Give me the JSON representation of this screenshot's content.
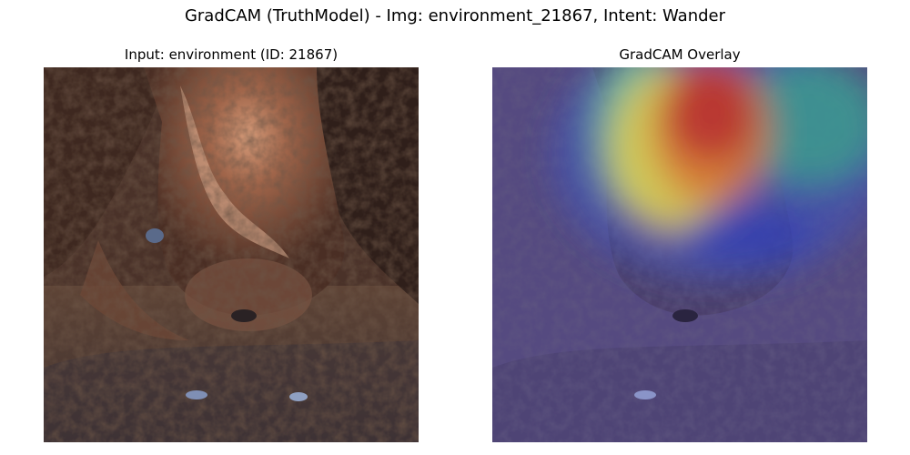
{
  "figure": {
    "title": "GradCAM (TruthModel) - Img: environment_21867, Intent: Wander"
  },
  "panels": [
    {
      "title": "Input: environment (ID: 21867)",
      "content": "cave rock photo"
    },
    {
      "title": "GradCAM Overlay",
      "content": "jet heatmap over rock photo"
    }
  ],
  "colors": {
    "background": "#ffffff",
    "text": "#000000",
    "heat_hot": "#c0302a",
    "heat_warm": "#e8d64a",
    "heat_cool": "#3a55c8",
    "overlay_base": "#5a4e86"
  }
}
